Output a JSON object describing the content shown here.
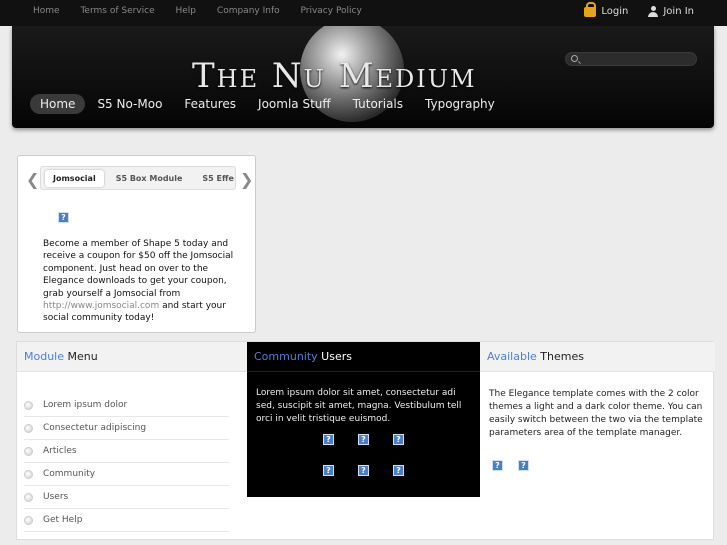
{
  "topbar": {
    "links": [
      "Home",
      "Terms of Service",
      "Help",
      "Company Info",
      "Privacy Policy"
    ],
    "login": "Login",
    "join": "Join In"
  },
  "header": {
    "title": "The Nu Medium",
    "nav": [
      "Home",
      "S5 No-Moo",
      "Features",
      "Joomla Stuff",
      "Tutorials",
      "Typography"
    ]
  },
  "module": {
    "tabs": [
      "Jomsocial",
      "S5 Box Module",
      "S5 Effe"
    ],
    "left_arrow": "❮",
    "right_arrow": "❯",
    "text_before": "Become a member of Shape 5 today and receive a coupon for $50 off the Jomsocial component. Just head on over to the Elegance downloads to get your coupon, grab yourself a Jomsocial from ",
    "link": "http://www.jomsocial.com",
    "text_after": " and start your social community today!",
    "icon_glyph": "?"
  },
  "col1": {
    "title_accent": "Module",
    "title_rest": " Menu",
    "items": [
      "Lorem ipsum dolor",
      "Consectetur adipiscing",
      "Articles",
      "Community",
      "Users",
      "Get Help"
    ]
  },
  "col2": {
    "title_accent": "Community",
    "title_rest": " Users",
    "text": "Lorem ipsum dolor sit amet, consectetur adi sed, suscipit sit amet, magna. Vestibulum tell orci in velit tristique euismod."
  },
  "col3": {
    "title_accent": "Available",
    "title_rest": " Themes",
    "text": "The Elegance template comes with the 2 color themes a light and a dark color theme. You can easily switch between the two via the template parameters area of the template manager."
  },
  "colors": {
    "accent": "#4d7fd4",
    "topbar": "#111111",
    "icon": "#4a7fc5"
  }
}
